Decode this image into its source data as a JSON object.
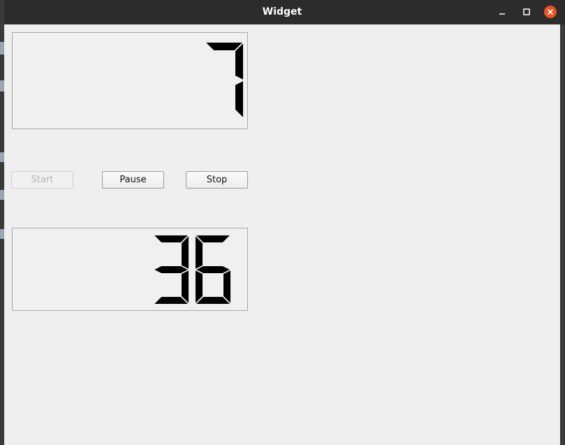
{
  "window": {
    "title": "Widget"
  },
  "titlebar_icons": {
    "minimize": "minimize-icon",
    "maximize": "maximize-icon",
    "close": "close-icon"
  },
  "lcd_top": {
    "value": "7"
  },
  "lcd_bottom": {
    "value": "36"
  },
  "buttons": {
    "start": {
      "label": "Start",
      "enabled": false
    },
    "pause": {
      "label": "Pause",
      "enabled": true
    },
    "stop": {
      "label": "Stop",
      "enabled": true
    }
  },
  "colors": {
    "accent_close": "#e95420",
    "segment": "#000000",
    "window_bg": "#efefef",
    "titlebar_bg": "#2c2c2c"
  }
}
